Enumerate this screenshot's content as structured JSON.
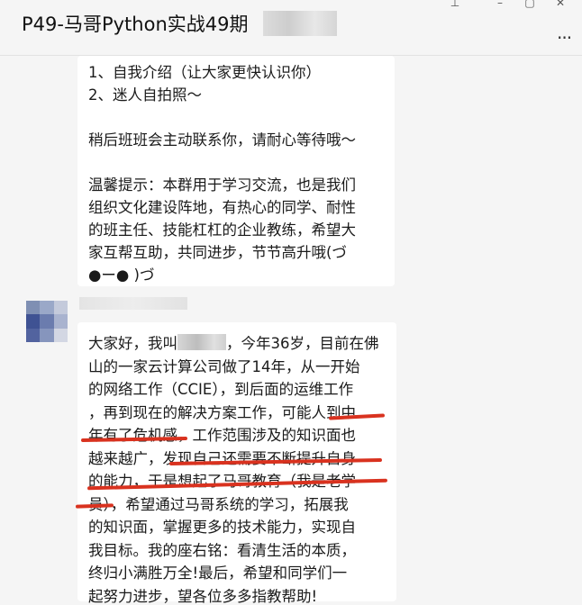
{
  "window": {
    "title": "P49-马哥Python实战49期",
    "pin_icon": "pin-icon",
    "minimize_icon": "minimize-icon",
    "maximize_icon": "maximize-icon",
    "close_icon": "close-icon",
    "more_icon": "more-icon"
  },
  "messages": [
    {
      "lines": [
        "1、自我介绍（让大家更快认识你）",
        "2、迷人自拍照～",
        "",
        "稍后班班会主动联系你，请耐心等待哦～",
        "",
        "温馨提示：本群用于学习交流，也是我们",
        "组织文化建设阵地，有热心的同学、耐性",
        "的班主任、技能杠杠的企业教练，希望大",
        "家互帮互助，共同进步，节节高升哦(づ",
        "●ー● )づ"
      ]
    },
    {
      "lines": [
        "大家好，我叫",
        "，今年36岁，目前在佛",
        "山的一家云计算公司做了14年，从一开始",
        "的网络工作（CCIE），到后面的运维工作",
        "，再到现在的解决方案工作，可能人到中",
        "年有了危机感，工作范围涉及的知识面也",
        "越来越广，发现自己还需要不断提升自身",
        "的能力，于是想起了马哥教育（我是老学",
        "员），希望通过马哥系统的学习，拓展我",
        "的知识面，掌握更多的技术能力，实现自",
        "我目标。我的座右铭：看清生活的本质，",
        "终归小满胜万全!最后，希望和同学们一",
        "起努力进步，望各位多多指教帮助!"
      ],
      "highlight_color": "#d9321f"
    }
  ]
}
